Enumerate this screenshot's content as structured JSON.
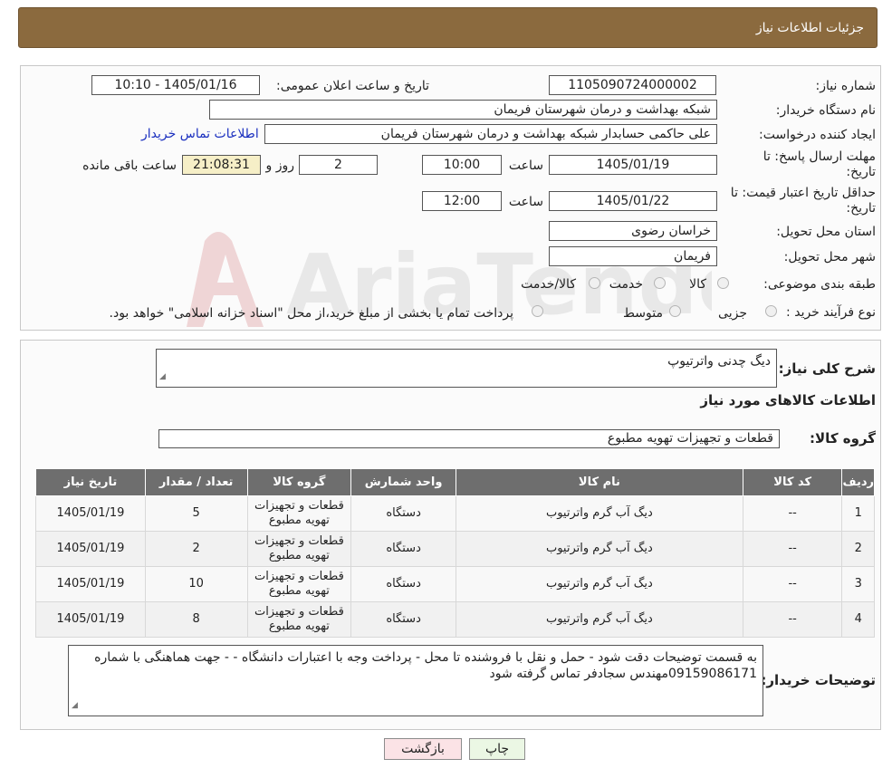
{
  "header": {
    "title": "جزئیات اطلاعات نیاز"
  },
  "fields": {
    "need_number_label": "شماره نیاز:",
    "need_number": "1105090724000002",
    "announce_label": "تاریخ و ساعت اعلان عمومی:",
    "announce_value": "1405/01/16 - 10:10",
    "buyer_org_label": "نام دستگاه خریدار:",
    "buyer_org": "شبکه بهداشت و درمان شهرستان فریمان",
    "creator_label": "ایجاد کننده درخواست:",
    "creator": "علی حاکمی حسابدار شبکه بهداشت و درمان شهرستان فریمان",
    "contact_link": "اطلاعات تماس خریدار",
    "deadline_label": "مهلت ارسال پاسخ: تا تاریخ:",
    "deadline_date": "1405/01/19",
    "time_label": "ساعت",
    "deadline_time": "10:00",
    "days": "2",
    "days_label": "روز و",
    "remaining": "21:08:31",
    "remaining_label": "ساعت باقی مانده",
    "validity_label": "حداقل تاریخ اعتبار قیمت: تا تاریخ:",
    "validity_date": "1405/01/22",
    "validity_time": "12:00",
    "province_label": "استان محل تحویل:",
    "province": "خراسان رضوی",
    "city_label": "شهر محل تحویل:",
    "city": "فریمان",
    "category_label": "طبقه بندی موضوعی:",
    "category_options": [
      "کالا",
      "خدمت",
      "کالا/خدمت"
    ],
    "process_label": "نوع فرآیند خرید :",
    "process_options": [
      "جزیی",
      "متوسط"
    ],
    "process_note": "پرداخت تمام یا بخشی از مبلغ خرید،از محل \"اسناد خزانه اسلامی\" خواهد بود."
  },
  "details": {
    "summary_label": "شرح کلی نیاز:",
    "summary": "دیگ چدنی واترتیوپ",
    "goods_info_title": "اطلاعات کالاهای مورد نیاز",
    "goods_group_label": "گروه کالا:",
    "goods_group": "قطعات و تجهیزات تهویه مطبوع",
    "buyer_notes_label": "توضیحات خریدار:",
    "buyer_notes": "به قسمت توضیحات  دقت شود - حمل و نقل با فروشنده تا محل  - پرداخت وجه  با اعتبارات دانشگاه -  - جهت هماهنگی با شماره 09159086171مهندس سجادفر تماس گرفته شود"
  },
  "table": {
    "headers": [
      "ردیف",
      "کد کالا",
      "نام کالا",
      "واحد شمارش",
      "گروه کالا",
      "تعداد / مقدار",
      "تاریخ نیاز"
    ],
    "rows": [
      [
        "1",
        "--",
        "دیگ آب گرم واترتیوب",
        "دستگاه",
        "قطعات و تجهیزات تهویه مطبوع",
        "5",
        "1405/01/19"
      ],
      [
        "2",
        "--",
        "دیگ آب گرم واترتیوب",
        "دستگاه",
        "قطعات و تجهیزات تهویه مطبوع",
        "2",
        "1405/01/19"
      ],
      [
        "3",
        "--",
        "دیگ آب گرم واترتیوب",
        "دستگاه",
        "قطعات و تجهیزات تهویه مطبوع",
        "10",
        "1405/01/19"
      ],
      [
        "4",
        "--",
        "دیگ آب گرم واترتیوب",
        "دستگاه",
        "قطعات و تجهیزات تهویه مطبوع",
        "8",
        "1405/01/19"
      ]
    ]
  },
  "buttons": {
    "print": "چاپ",
    "back": "بازگشت"
  },
  "watermark": "AriaTender.neT",
  "colors": {
    "header_bg": "#8b6a3e",
    "table_header_bg": "#6e6e6e",
    "link": "#1a2fbf",
    "back_button_bg": "#fbe3e6",
    "print_button_bg": "#ebf7e4",
    "remaining_bg": "#f6efc7"
  }
}
